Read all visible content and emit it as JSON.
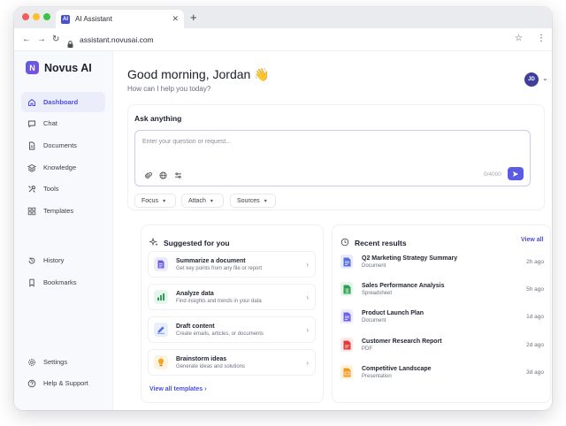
{
  "browser": {
    "tab_title": "AI Assistant",
    "tab_favicon": "AI",
    "new_tab": "+",
    "url": "assistant.novusai.com"
  },
  "sidebar": {
    "brand_logo": "N",
    "brand_name": "Novus AI",
    "items": [
      {
        "label": "Dashboard",
        "icon": "home-icon"
      },
      {
        "label": "Chat",
        "icon": "chat-icon"
      },
      {
        "label": "Documents",
        "icon": "document-icon"
      },
      {
        "label": "Knowledge",
        "icon": "layers-icon"
      },
      {
        "label": "Tools",
        "icon": "tools-icon"
      },
      {
        "label": "Templates",
        "icon": "grid-icon"
      },
      {
        "label": "History",
        "icon": "history-icon"
      },
      {
        "label": "Bookmarks",
        "icon": "bookmark-icon"
      },
      {
        "label": "Settings",
        "icon": "gear-icon"
      },
      {
        "label": "Help & Support",
        "icon": "help-icon"
      }
    ]
  },
  "header": {
    "greeting": "Good morning, Jordan 👋",
    "subtitle": "How can I help you today?",
    "avatar_initials": "JD"
  },
  "ask": {
    "title": "Ask anything",
    "placeholder": "Enter your question or request...",
    "char_count": "0/4000",
    "pills": [
      {
        "label": "Focus"
      },
      {
        "label": "Attach"
      },
      {
        "label": "Sources"
      }
    ]
  },
  "suggested": {
    "title": "Suggested for you",
    "items": [
      {
        "title": "Summarize a document",
        "desc": "Get key points from any file or report"
      },
      {
        "title": "Analyze data",
        "desc": "Find insights and trends in your data"
      },
      {
        "title": "Draft content",
        "desc": "Create emails, articles, or documents"
      },
      {
        "title": "Brainstorm ideas",
        "desc": "Generate ideas and solutions"
      }
    ],
    "view_all": "View all templates  ›"
  },
  "recent": {
    "title": "Recent results",
    "view_all": "View all",
    "items": [
      {
        "title": "Q2 Marketing Strategy Summary",
        "type": "Document",
        "time": "2h ago",
        "icon": "doc-icon"
      },
      {
        "title": "Sales Performance Analysis",
        "type": "Spreadsheet",
        "time": "5h ago",
        "icon": "spreadsheet-icon"
      },
      {
        "title": "Product Launch Plan",
        "type": "Document",
        "time": "1d ago",
        "icon": "doc-icon"
      },
      {
        "title": "Customer Research Report",
        "type": "PDF",
        "time": "2d ago",
        "icon": "pdf-icon"
      },
      {
        "title": "Competitive Landscape",
        "type": "Presentation",
        "time": "3d ago",
        "icon": "presentation-icon"
      }
    ]
  },
  "colors": {
    "accent": "#5a5de3",
    "active_bg": "#ebedfb",
    "doc": "#5a6ee0",
    "sheet": "#2f9e58",
    "pdf": "#e23b3b",
    "presentation": "#f29a1f"
  }
}
